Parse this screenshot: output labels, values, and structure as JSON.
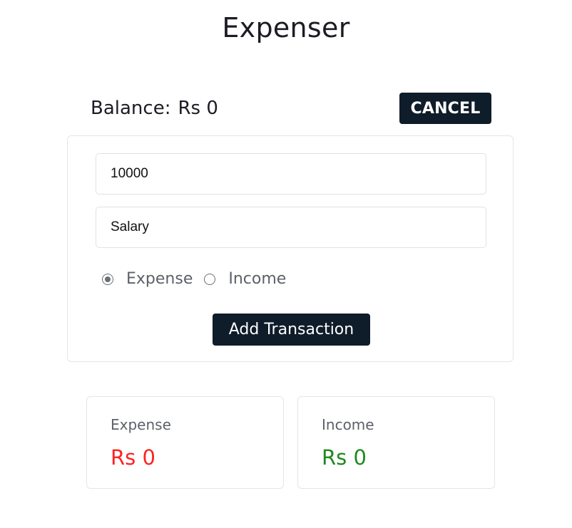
{
  "app": {
    "title": "Expenser"
  },
  "balance": {
    "label": "Balance:",
    "value": "Rs 0"
  },
  "cancel_button": {
    "label": "CANCEL"
  },
  "form": {
    "amount_input": {
      "value": "10000"
    },
    "description_input": {
      "value": "Salary"
    },
    "type_options": [
      {
        "label": "Expense",
        "checked": true
      },
      {
        "label": "Income",
        "checked": false
      }
    ],
    "submit_button": {
      "label": "Add Transaction"
    }
  },
  "summary": {
    "expense": {
      "label": "Expense",
      "value": "Rs 0",
      "color": "#ff2222"
    },
    "income": {
      "label": "Income",
      "value": "Rs 0",
      "color": "#1e8a1e"
    }
  },
  "colors": {
    "primary_button": "#0f1c2a",
    "card_border": "#e3e5ea"
  }
}
